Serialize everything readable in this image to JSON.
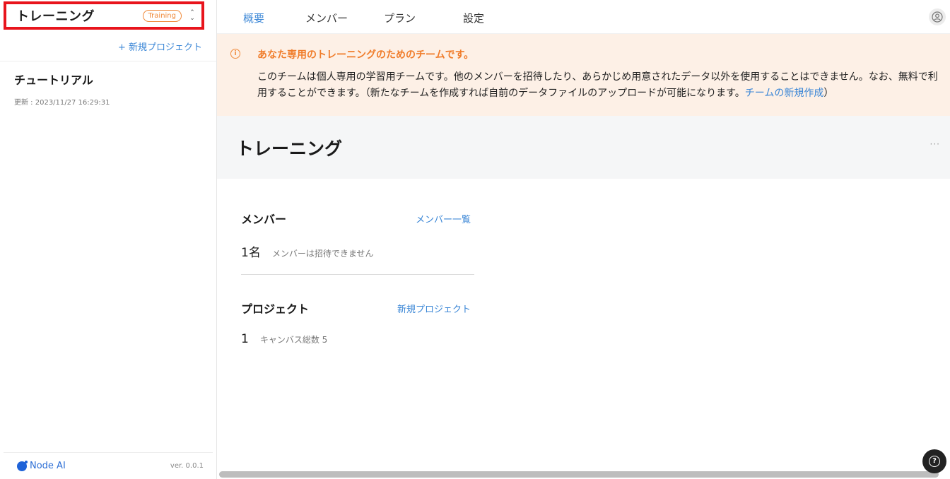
{
  "sidebar": {
    "team_name": "トレーニング",
    "team_badge": "Training",
    "new_project": "+ 新規プロジェクト",
    "projects": [
      {
        "name": "チュートリアル",
        "updated": "更新 : 2023/11/27 16:29:31"
      }
    ],
    "footer": {
      "brand": "Node AI",
      "version": "ver. 0.0.1"
    }
  },
  "nav": {
    "tabs": [
      {
        "label": "概要",
        "active": true
      },
      {
        "label": "メンバー",
        "active": false
      },
      {
        "label": "プラン",
        "active": false
      },
      {
        "label": "設定",
        "active": false
      }
    ]
  },
  "notice": {
    "title": "あなた専用のトレーニングのためのチームです。",
    "body": "このチームは個人専用の学習用チームです。他のメンバーを招待したり、あらかじめ用意されたデータ以外を使用することはできません。なお、無料で利用することができます。（新たなチームを作成すれば自前のデータファイルのアップロードが可能になります。",
    "link": "チームの新規作成",
    "close": "）"
  },
  "team_header": {
    "title": "トレーニング",
    "more": "···"
  },
  "members": {
    "title": "メンバー",
    "link": "メンバー一覧",
    "count": "1名",
    "note": "メンバーは招待できません"
  },
  "projects": {
    "title": "プロジェクト",
    "link": "新規プロジェクト",
    "count": "1",
    "note": "キャンバス総数 5"
  },
  "colors": {
    "accent": "#3a86d6",
    "warning": "#f07c2a",
    "highlight_border": "#e8141c",
    "notice_bg": "#fdf0e6"
  }
}
